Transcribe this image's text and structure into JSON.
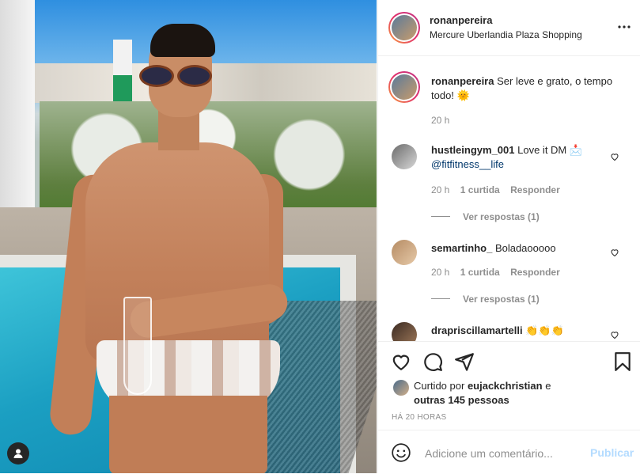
{
  "post": {
    "author": "ronanpereira",
    "location": "Mercure Uberlandia Plaza Shopping",
    "caption_text": "Ser leve e grato, o tempo todo! 🌞",
    "caption_time": "20 h"
  },
  "comments": [
    {
      "user": "hustleingym_001",
      "text": "Love it DM 📩",
      "mention": "@fitfitness__life",
      "time": "20 h",
      "likes": "1 curtida",
      "reply": "Responder",
      "view_replies": "Ver respostas (1)"
    },
    {
      "user": "semartinho_",
      "text": "Boladaooooo",
      "time": "20 h",
      "likes": "1 curtida",
      "reply": "Responder",
      "view_replies": "Ver respostas (1)"
    },
    {
      "user": "drapriscillamartelli",
      "text": "👏👏👏"
    }
  ],
  "likes": {
    "prefix": "Curtido por",
    "user": "eujackchristian",
    "connector": "e",
    "others": "outras 145 pessoas"
  },
  "timestamp": "HÁ 20 HORAS",
  "add_comment": {
    "placeholder": "Adicione um comentário...",
    "publish": "Publicar"
  },
  "icons": {
    "more": "more-options-icon",
    "like": "heart-icon",
    "comment": "comment-icon",
    "share": "direct-share-icon",
    "save": "bookmark-icon",
    "emoji": "emoji-icon",
    "tags": "user-tag-icon"
  },
  "colors": {
    "link": "#00376b",
    "muted": "#8e8e8e",
    "publish_disabled": "#b3dbff"
  }
}
